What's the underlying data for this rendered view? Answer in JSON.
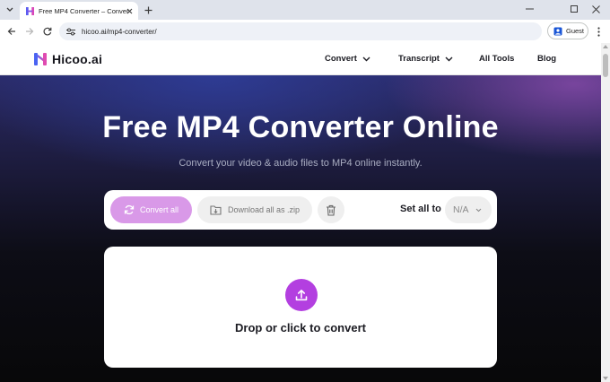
{
  "browser": {
    "tab_title": "Free MP4 Converter – Convert Vi",
    "url": "hicoo.ai/mp4-converter/",
    "profile_label": "Guest"
  },
  "site": {
    "logo_text": "Hicoo.ai",
    "nav": [
      {
        "label": "Convert",
        "has_dropdown": true
      },
      {
        "label": "Transcript",
        "has_dropdown": true
      },
      {
        "label": "All Tools",
        "has_dropdown": false
      },
      {
        "label": "Blog",
        "has_dropdown": false
      }
    ]
  },
  "hero": {
    "title": "Free MP4 Converter Online",
    "subtitle": "Convert your video & audio files to MP4 online instantly."
  },
  "actions": {
    "convert_all": "Convert all",
    "download_zip": "Download all as .zip",
    "set_all_label": "Set all to",
    "format_value": "N/A"
  },
  "dropzone": {
    "text": "Drop or click to convert"
  },
  "colors": {
    "accent": "#b33fe0",
    "convert_button": "#d999e8"
  }
}
